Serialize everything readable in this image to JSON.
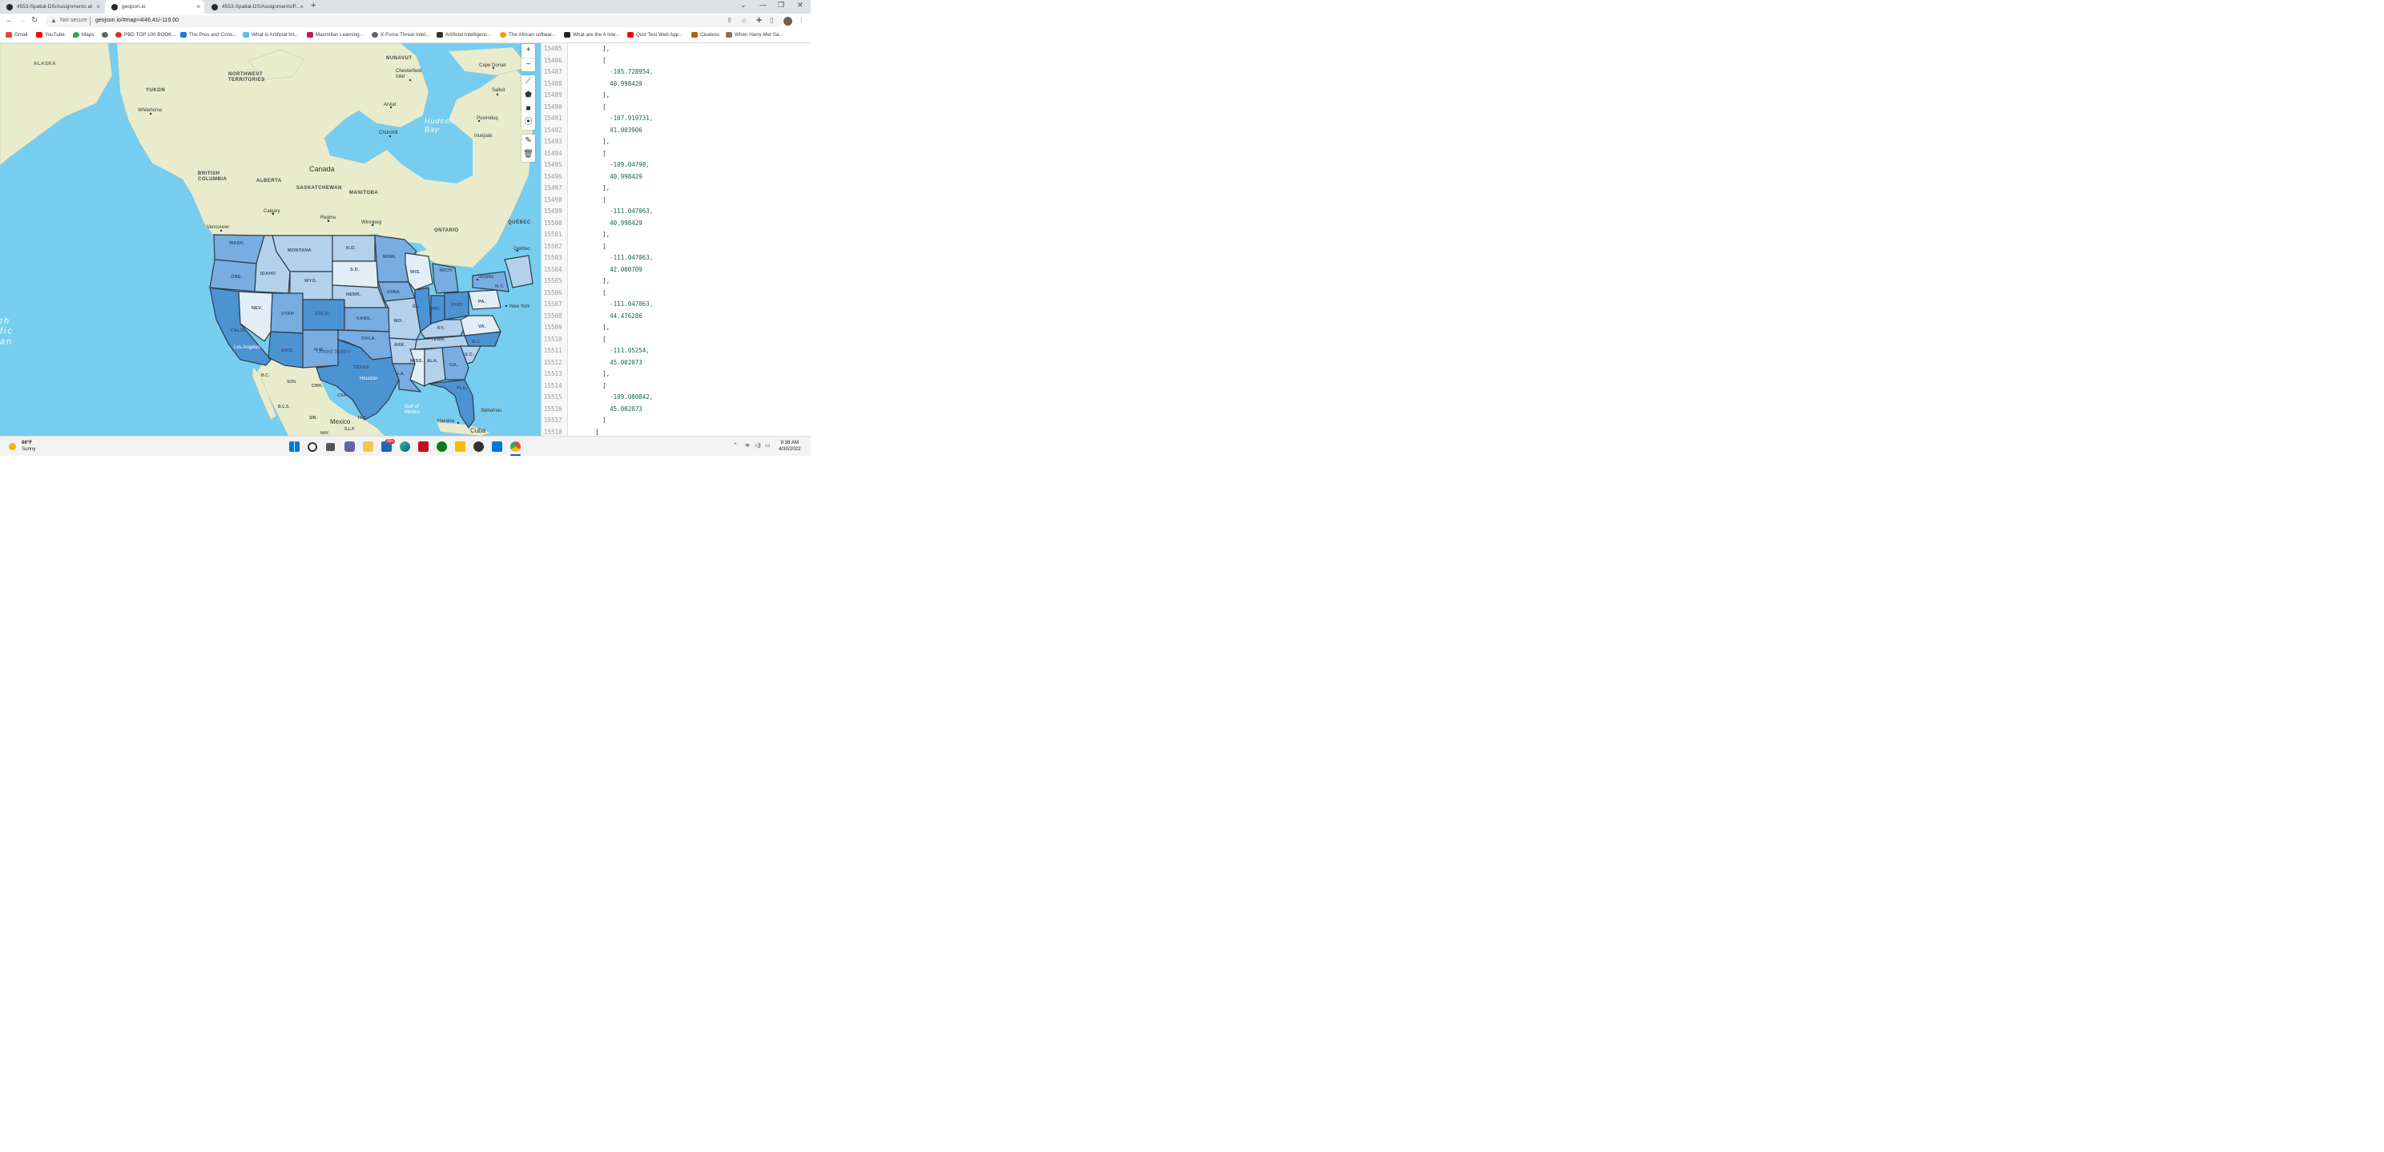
{
  "browser": {
    "tabs": [
      {
        "title": "4553-Spatial-DS/Assignments at"
      },
      {
        "title": "geojson.io"
      },
      {
        "title": "4553-Spatial-DS/Assignments/P..."
      }
    ],
    "new_tab": "+",
    "address": {
      "security": "Not secure",
      "url": "geojson.io/#map=4/46.41/-119.00"
    },
    "bookmarks": [
      "Gmail",
      "YouTube",
      "Maps",
      "",
      "PBD TOP 100 BOOK...",
      "The Pros and Cons...",
      "What is Artificial Int...",
      "Macmillan Learning...",
      "X-Force Threat Intel...",
      "Artificial Intelligenc...",
      "The African softwar...",
      "What are the 4 Inte...",
      "Quiz Test Web App...",
      "Clueless",
      "When Harry Met Sa..."
    ]
  },
  "map": {
    "labels": {
      "alaska": "ALASKA",
      "yukon": "YUKON",
      "nwt": "NORTHWEST\nTERRITORIES",
      "nunavut": "NUNAVUT",
      "bc": "BRITISH\nCOLUMBIA",
      "alberta": "ALBERTA",
      "saskatchewan": "SASKATCHEWAN",
      "manitoba": "MANITOBA",
      "ontario": "ONTARIO",
      "quebec": "QUÉBEC",
      "canada": "Canada",
      "hudson": "Hudson\nBay",
      "whitehorse": "Whitehorse",
      "chesterfield": "Chesterfield\nInlet",
      "cape_dorset": "Cape Dorset",
      "arviat": "Arviat",
      "churchill": "Churchill",
      "puvirnituq": "Puvirnituq",
      "inukjuak": "Inukjuak",
      "salluit": "Salluit",
      "calgary": "Calgary",
      "regina": "Regina",
      "winnipeg": "Winnipeg",
      "vancouver": "Vancouver",
      "toronto": "Toronto",
      "quebec_city": "Québec",
      "new_york": "New York",
      "los_angeles": "Los Angeles",
      "houston": "Houston",
      "havana": "Havana",
      "bahamas": "Bahamas",
      "cuba": "Cuba",
      "mexico": "Mexico",
      "gulf": "Gulf of\nMexico",
      "united_states": "United States",
      "ocean": "th\nfic\nan",
      "bc_mx": "B.C.",
      "bcs": "B.C.S.",
      "son": "SON.",
      "chih": "CHIH.",
      "coa": "COA.",
      "sin": "SIN.",
      "tam": "TAM.",
      "slp": "S.L.P.",
      "nay": "NAY.",
      "wash": "WASH.",
      "ore": "ORE.",
      "calif": "CALIF.",
      "idaho": "IDAHO",
      "nev": "NEV.",
      "utah": "UTAH",
      "ariz": "ARIZ.",
      "montana": "MONTANA",
      "wyo": "WYO.",
      "colo": "COLO.",
      "nm": "N.M.",
      "nd": "N.D.",
      "sd": "S.D.",
      "nebr": "NEBR.",
      "kans": "KANS.",
      "okla": "OKLA.",
      "texas": "TEXAS",
      "minn": "MINN.",
      "iowa": "IOWA",
      "mo": "MO.",
      "ark": "ARK.",
      "la": "LA.",
      "wis": "WIS.",
      "ill": "ILL.",
      "mich": "MICH.",
      "ind": "IND.",
      "ohio": "OHIO",
      "ky": "KY.",
      "tenn": "TENN.",
      "miss": "MISS.",
      "ala": "ALA.",
      "ga": "GA.",
      "fla": "FLA.",
      "sc": "S.C.",
      "nc": "N.C.",
      "va": "VA.",
      "pa": "PA.",
      "ny": "N.Y."
    },
    "controls": [
      "+",
      "−",
      "draw-line",
      "draw-polygon",
      "draw-rectangle",
      "draw-marker",
      "edit",
      "delete"
    ]
  },
  "editor": {
    "lines": [
      {
        "n": "15485",
        "t": "        ],"
      },
      {
        "n": "15486",
        "t": "        ["
      },
      {
        "n": "15487",
        "t": "          -105.728954,"
      },
      {
        "n": "15488",
        "t": "          40.998429"
      },
      {
        "n": "15489",
        "t": "        ],"
      },
      {
        "n": "15490",
        "t": "        ["
      },
      {
        "n": "15491",
        "t": "          -107.919731,"
      },
      {
        "n": "15492",
        "t": "          41.003906"
      },
      {
        "n": "15493",
        "t": "        ],"
      },
      {
        "n": "15494",
        "t": "        ["
      },
      {
        "n": "15495",
        "t": "          -109.04798,"
      },
      {
        "n": "15496",
        "t": "          40.998429"
      },
      {
        "n": "15497",
        "t": "        ],"
      },
      {
        "n": "15498",
        "t": "        ["
      },
      {
        "n": "15499",
        "t": "          -111.047063,"
      },
      {
        "n": "15500",
        "t": "          40.998429"
      },
      {
        "n": "15501",
        "t": "        ],"
      },
      {
        "n": "15502",
        "t": "        ["
      },
      {
        "n": "15503",
        "t": "          -111.047063,"
      },
      {
        "n": "15504",
        "t": "          42.000709"
      },
      {
        "n": "15505",
        "t": "        ],"
      },
      {
        "n": "15506",
        "t": "        ["
      },
      {
        "n": "15507",
        "t": "          -111.047063,"
      },
      {
        "n": "15508",
        "t": "          44.476286"
      },
      {
        "n": "15509",
        "t": "        ],"
      },
      {
        "n": "15510",
        "t": "        ["
      },
      {
        "n": "15511",
        "t": "          -111.05254,"
      },
      {
        "n": "15512",
        "t": "          45.002073"
      },
      {
        "n": "15513",
        "t": "        ],"
      },
      {
        "n": "15514",
        "t": "        ["
      },
      {
        "n": "15515",
        "t": "          -109.080842,"
      },
      {
        "n": "15516",
        "t": "          45.002073"
      },
      {
        "n": "15517",
        "t": "        ]"
      },
      {
        "n": "15518",
        "t": "      ]"
      }
    ]
  },
  "taskbar": {
    "temp": "66°F",
    "condition": "Sunny",
    "badge": "99+",
    "time": "9:38 AM",
    "date": "4/30/2022"
  },
  "colors": {
    "water": "#76cdf0",
    "land": "#e8eccd",
    "state_dark": "#4c93d4",
    "state_mid": "#77ade0",
    "state_light": "#b4d1ec",
    "state_pale": "#e2edf6",
    "json_number": "#116644"
  }
}
